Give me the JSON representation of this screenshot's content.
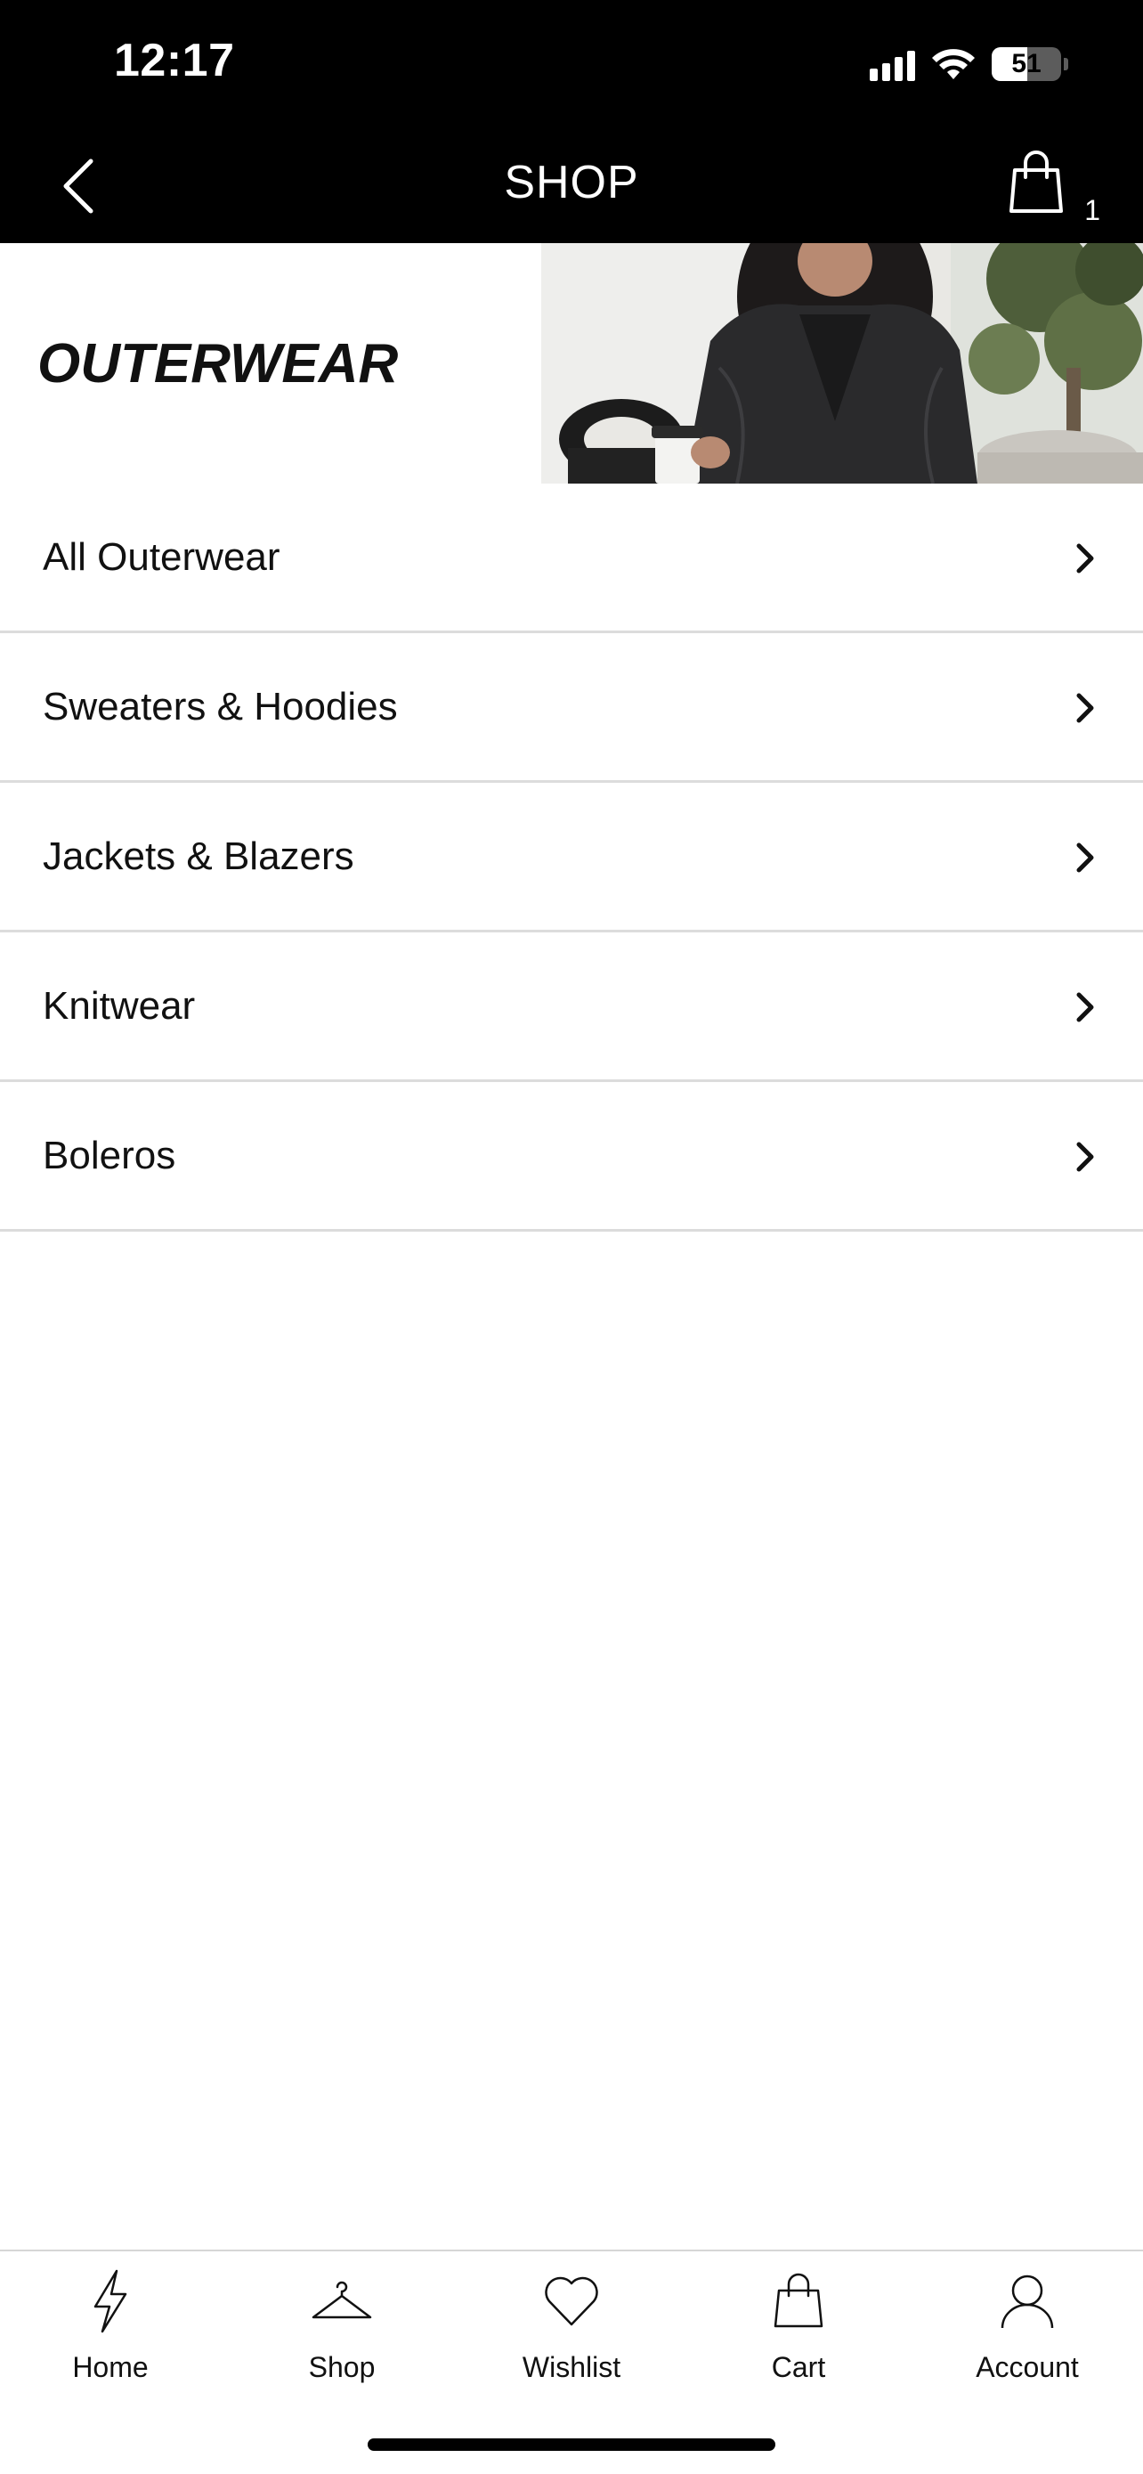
{
  "status_bar": {
    "time": "12:17",
    "battery_level": "51"
  },
  "nav": {
    "title": "SHOP",
    "cart_count": "1"
  },
  "banner": {
    "title": "OUTERWEAR"
  },
  "categories": [
    {
      "label": "All Outerwear"
    },
    {
      "label": "Sweaters & Hoodies"
    },
    {
      "label": "Jackets & Blazers"
    },
    {
      "label": "Knitwear"
    },
    {
      "label": "Boleros"
    }
  ],
  "tab_bar": {
    "items": [
      {
        "label": "Home",
        "icon": "lightning-icon"
      },
      {
        "label": "Shop",
        "icon": "hanger-icon"
      },
      {
        "label": "Wishlist",
        "icon": "heart-icon"
      },
      {
        "label": "Cart",
        "icon": "bag-icon"
      },
      {
        "label": "Account",
        "icon": "person-icon"
      }
    ]
  },
  "colors": {
    "header_bg": "#000000",
    "divider": "#dcdcdc",
    "text": "#111111"
  }
}
